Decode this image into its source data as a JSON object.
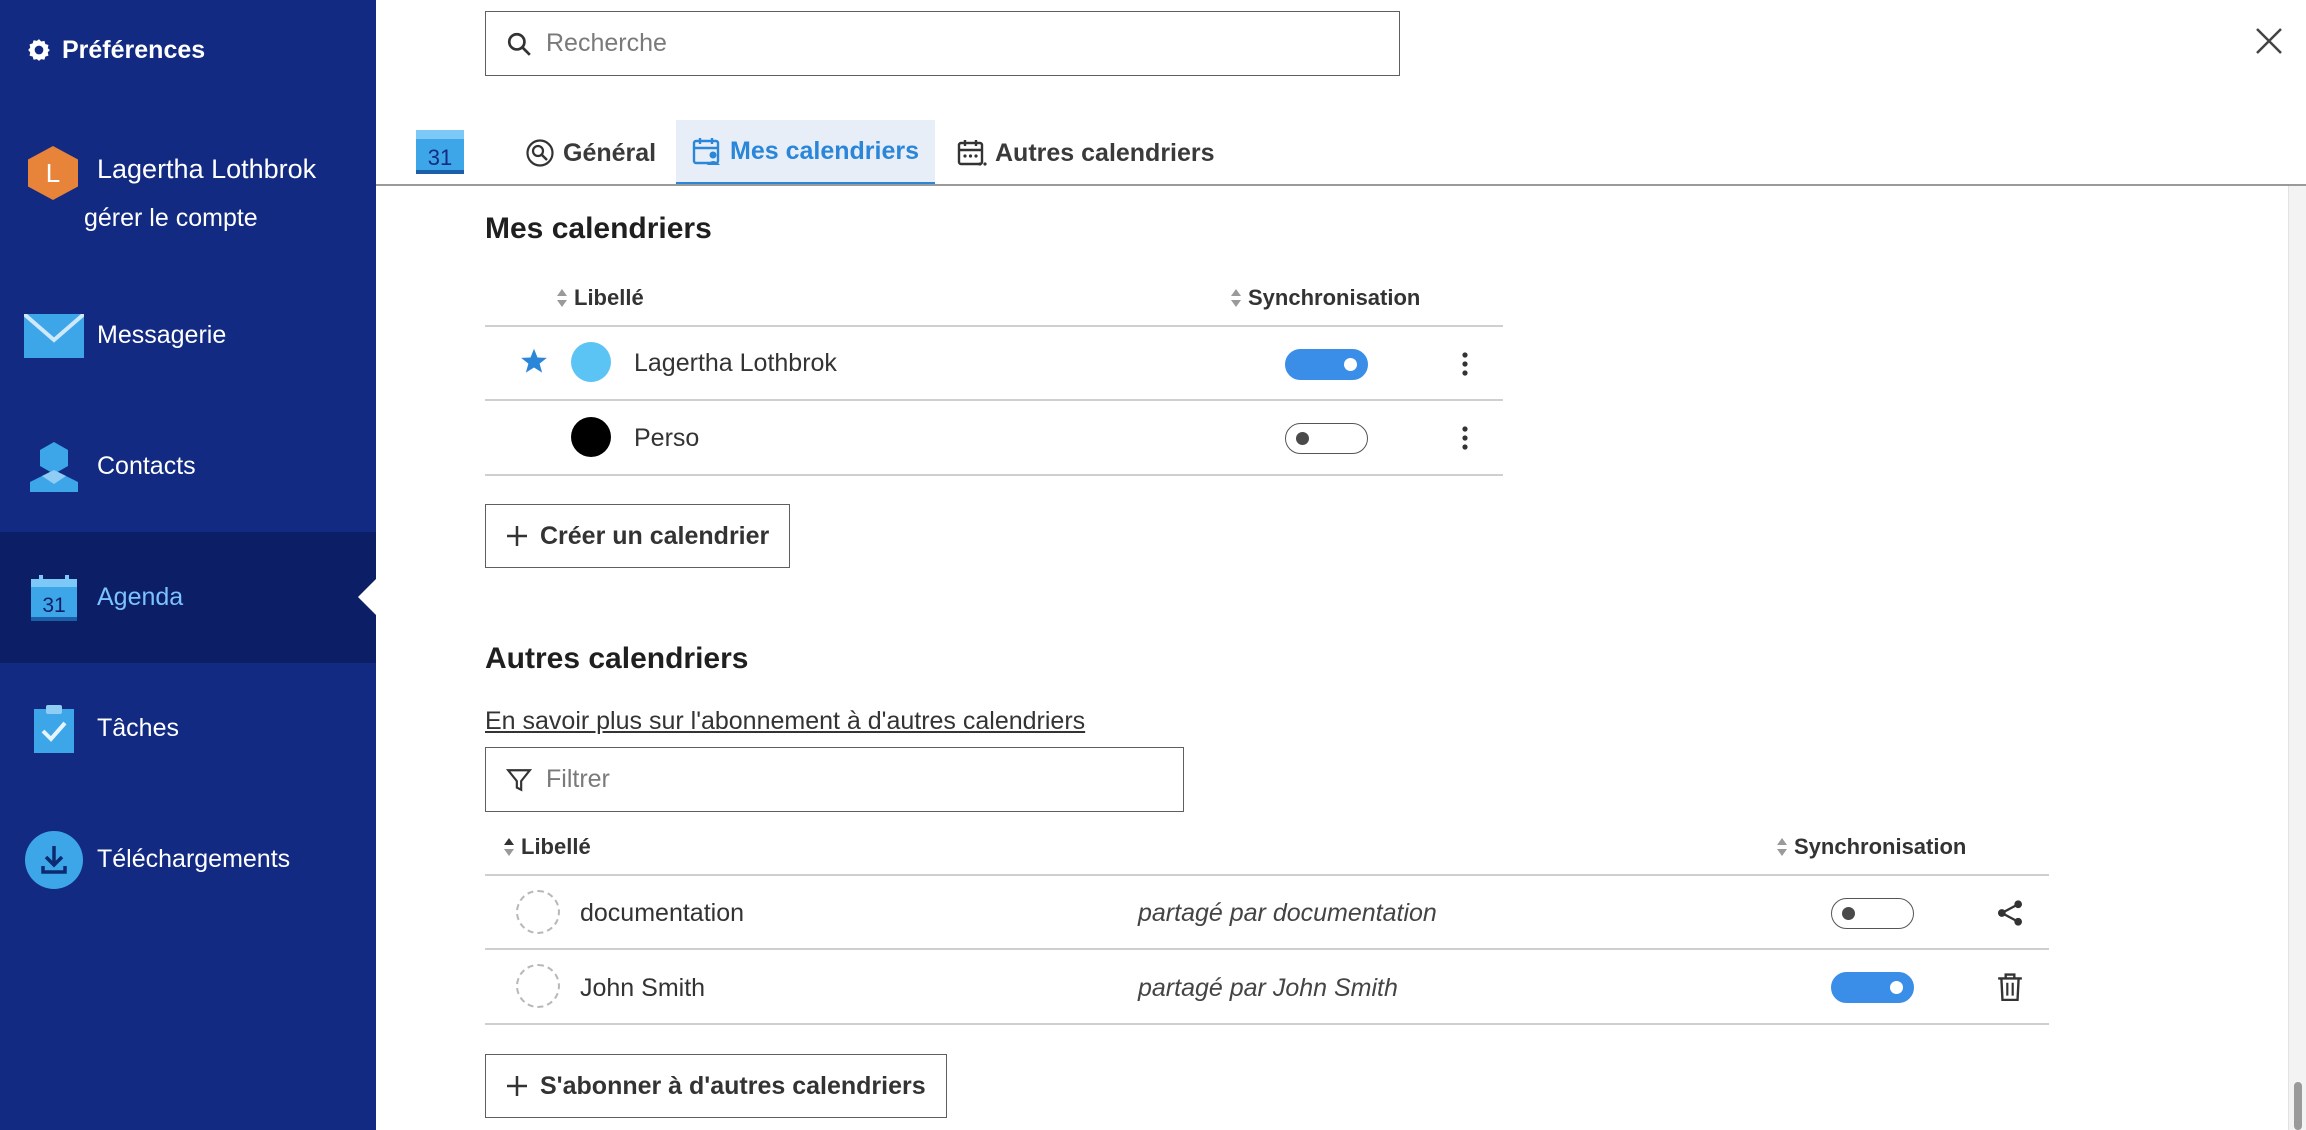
{
  "sidebar": {
    "title": "Préférences",
    "account": {
      "initial": "L",
      "name": "Lagertha Lothbrok",
      "manage_label": "gérer le compte",
      "avatar_color": "#e8833a"
    },
    "items": [
      {
        "label": "Messagerie",
        "icon": "envelope-icon"
      },
      {
        "label": "Contacts",
        "icon": "contact-icon"
      },
      {
        "label": "Agenda",
        "icon": "calendar-icon",
        "active": true
      },
      {
        "label": "Tâches",
        "icon": "clipboard-check-icon"
      },
      {
        "label": "Téléchargements",
        "icon": "download-icon"
      }
    ],
    "calendar_day": "31"
  },
  "search": {
    "placeholder": "Recherche"
  },
  "header": {
    "app_calendar_day": "31",
    "tabs": [
      {
        "label": "Général",
        "icon": "settings-search-icon"
      },
      {
        "label": "Mes calendriers",
        "icon": "calendar-user-icon",
        "active": true
      },
      {
        "label": "Autres calendriers",
        "icon": "calendar-dots-icon"
      }
    ]
  },
  "my_calendars": {
    "title": "Mes calendriers",
    "columns": {
      "label": "Libellé",
      "sync": "Synchronisation"
    },
    "rows": [
      {
        "name": "Lagertha Lothbrok",
        "color": "#5bc4f5",
        "default": true,
        "sync": true
      },
      {
        "name": "Perso",
        "color": "#000000",
        "default": false,
        "sync": false
      }
    ],
    "create_button": "Créer un calendrier"
  },
  "other_calendars": {
    "title": "Autres calendriers",
    "learn_more_link": "En savoir plus sur l'abonnement à d'autres calendriers",
    "filter_placeholder": "Filtrer",
    "columns": {
      "label": "Libellé",
      "sync": "Synchronisation"
    },
    "rows": [
      {
        "name": "documentation",
        "shared_by": "partagé par documentation",
        "sync": false,
        "action": "share-icon"
      },
      {
        "name": "John Smith",
        "shared_by": "partagé par John Smith",
        "sync": true,
        "action": "trash-icon"
      }
    ],
    "subscribe_button": "S'abonner à d'autres calendriers"
  },
  "colors": {
    "sidebar_bg": "#122a82",
    "sidebar_active_bg": "#0c1f66",
    "accent": "#2a86d9",
    "toggle_on": "#3a8ee8"
  }
}
